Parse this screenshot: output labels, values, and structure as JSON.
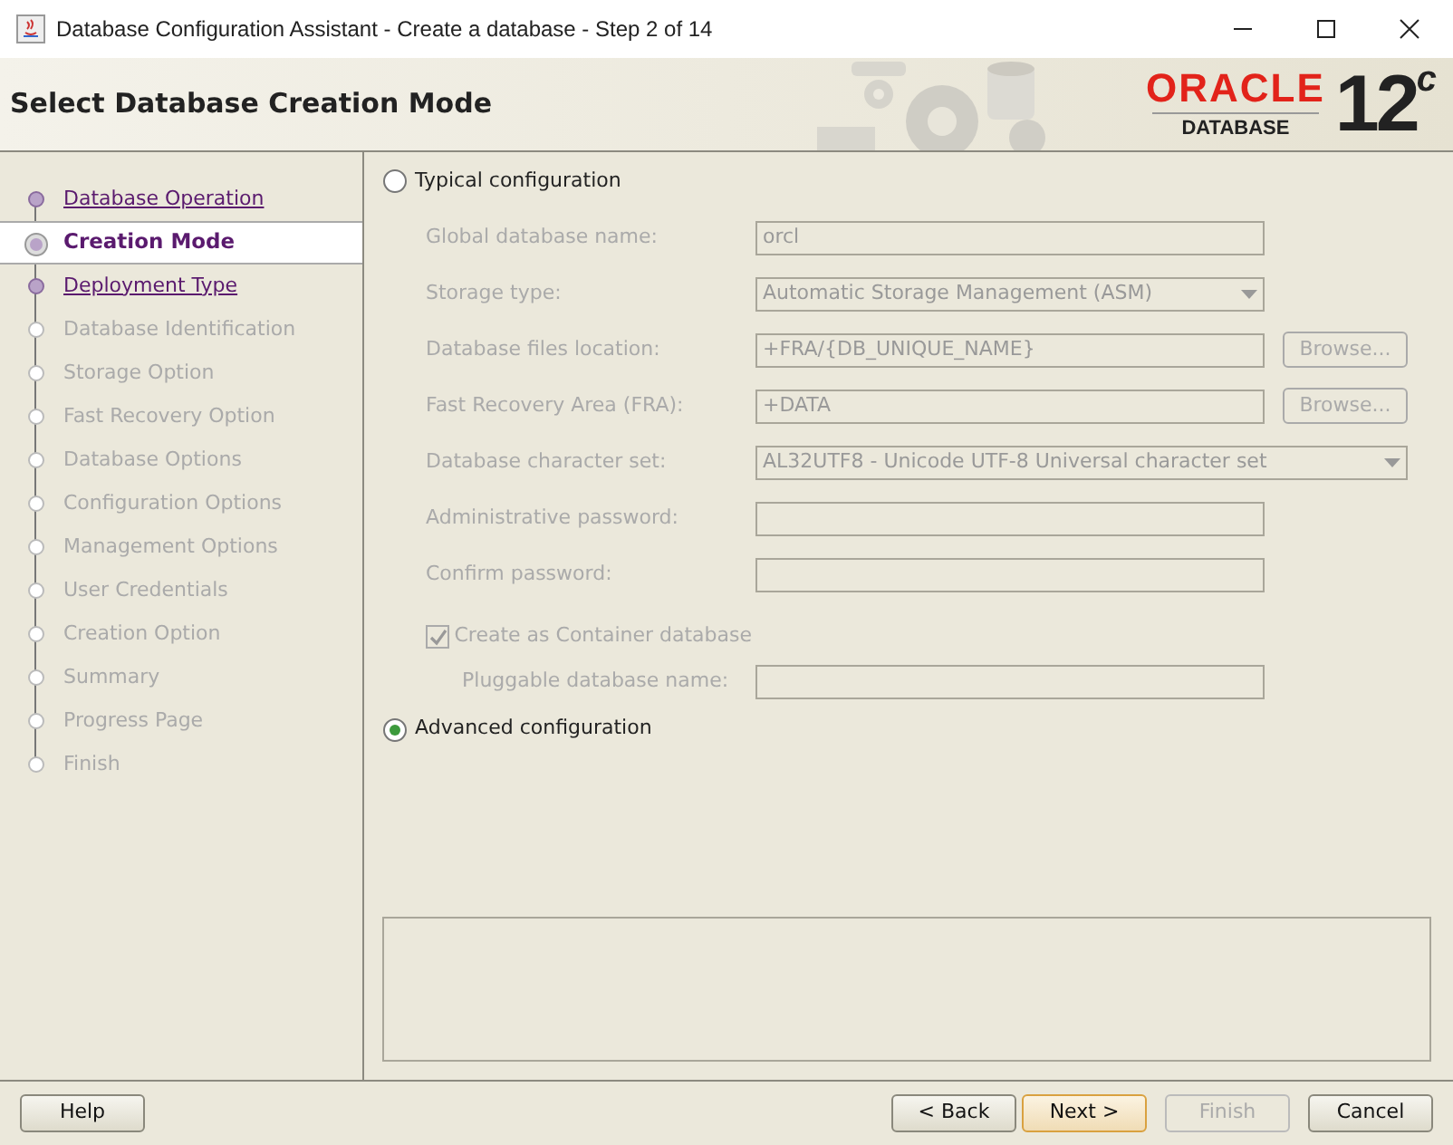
{
  "window": {
    "title": "Database Configuration Assistant - Create a database - Step 2 of 14"
  },
  "header": {
    "title": "Select Database Creation Mode",
    "logo": {
      "brand": "ORACLE",
      "product": "DATABASE",
      "version": "12$^{c}$"
    }
  },
  "steps": [
    {
      "label": "Database Operation",
      "selected": false,
      "disabled": false
    },
    {
      "label": "Creation Mode",
      "selected": true,
      "disabled": false
    },
    {
      "label": "Deployment Type",
      "selected": false,
      "disabled": false
    },
    {
      "label": "Database Identification",
      "selected": false,
      "disabled": true
    },
    {
      "label": "Storage Option",
      "selected": false,
      "disabled": true
    },
    {
      "label": "Fast Recovery Option",
      "selected": false,
      "disabled": true
    },
    {
      "label": "Database Options",
      "selected": false,
      "disabled": true
    },
    {
      "label": "Configuration Options",
      "selected": false,
      "disabled": true
    },
    {
      "label": "Management Options",
      "selected": false,
      "disabled": true
    },
    {
      "label": "User Credentials",
      "selected": false,
      "disabled": true
    },
    {
      "label": "Creation Option",
      "selected": false,
      "disabled": true
    },
    {
      "label": "Summary",
      "selected": false,
      "disabled": true
    },
    {
      "label": "Progress Page",
      "selected": false,
      "disabled": true
    },
    {
      "label": "Finish",
      "selected": false,
      "disabled": true
    }
  ],
  "modes": [
    {
      "label": "Typical configuration",
      "selected": false,
      "disabled": true,
      "fields": [
        {
          "kind": "text",
          "label": "Global database name:",
          "value": "orcl"
        },
        {
          "kind": "select",
          "label": "Storage type:",
          "value": "Automatic Storage Management (ASM)"
        },
        {
          "kind": "text",
          "label": "Database files location:",
          "value": "+FRA/{DB_UNIQUE_NAME}",
          "button": "Browse..."
        },
        {
          "kind": "text",
          "label": "Fast Recovery Area (FRA):",
          "value": "+DATA",
          "button": "Browse..."
        },
        {
          "kind": "wideselect",
          "label": "Database character set:",
          "value": "AL32UTF8 - Unicode UTF-8 Universal character set"
        },
        {
          "kind": "password",
          "label": "Administrative password:"
        },
        {
          "kind": "password",
          "label": "Confirm password:"
        }
      ],
      "container": {
        "label": "Create as Container database",
        "checked": true,
        "pluggable_label": "Pluggable database name:"
      }
    },
    {
      "label": "Advanced configuration",
      "selected": true
    }
  ],
  "buttons": [
    {
      "kind": "help",
      "label": "Help",
      "disabled": false,
      "focused": false
    },
    {
      "kind": "nav",
      "label": "< Back",
      "disabled": false,
      "focused": false
    },
    {
      "kind": "nav",
      "label": "Next >",
      "disabled": false,
      "focused": true
    },
    {
      "kind": "nav",
      "label": "Finish",
      "disabled": true,
      "focused": false
    },
    {
      "kind": "nav",
      "label": "Cancel",
      "disabled": false,
      "focused": false
    }
  ]
}
